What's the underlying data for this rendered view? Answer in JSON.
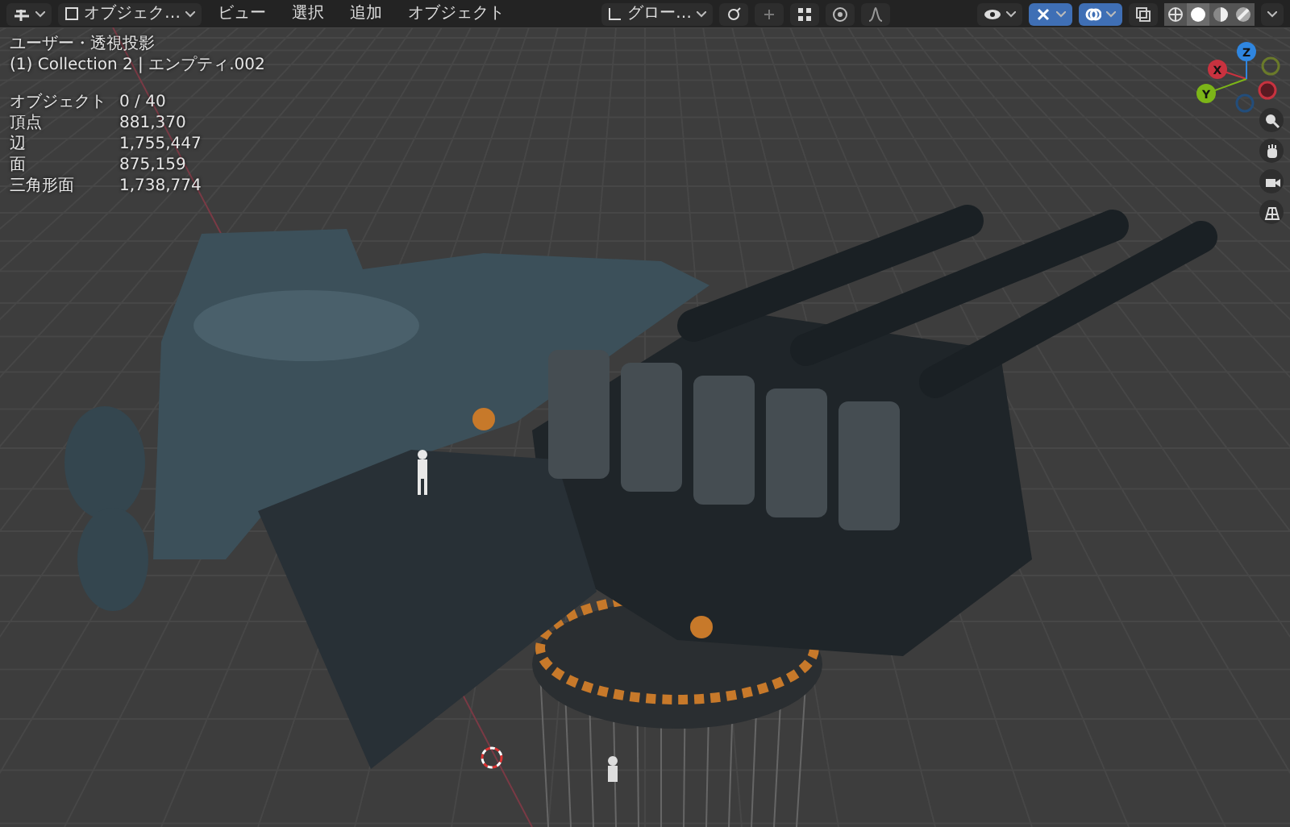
{
  "header": {
    "mode": "オブジェク…",
    "menus": [
      "ビュー",
      "選択",
      "追加",
      "オブジェクト"
    ],
    "orientation": "グロー…",
    "toggles": [
      {
        "kind": "gizmo",
        "on": true
      },
      {
        "kind": "overlay",
        "on": true
      },
      {
        "kind": "xray",
        "on": false
      }
    ],
    "shading": [
      {
        "kind": "wireframe",
        "selected": false
      },
      {
        "kind": "solid",
        "selected": true
      },
      {
        "kind": "material",
        "selected": false
      },
      {
        "kind": "rendered",
        "selected": false
      }
    ]
  },
  "viewport": {
    "view_name": "ユーザー・透視投影",
    "collection": "(1) Collection 2 | エンプティ.002",
    "stats": [
      {
        "label": "オブジェクト",
        "value": "0 / 40"
      },
      {
        "label": "頂点",
        "value": "881,370"
      },
      {
        "label": "辺",
        "value": "1,755,447"
      },
      {
        "label": "面",
        "value": "875,159"
      },
      {
        "label": "三角形面",
        "value": "1,738,774"
      }
    ],
    "gizmo": [
      "X",
      "Y",
      "Z"
    ]
  }
}
